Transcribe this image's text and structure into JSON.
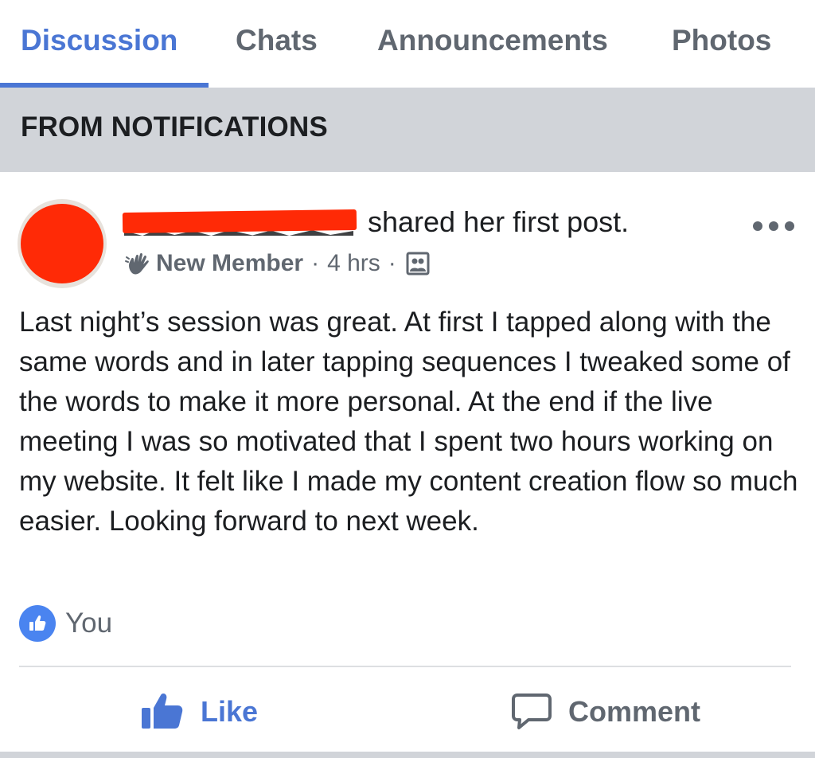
{
  "tabs": [
    {
      "label": "Discussion",
      "active": true
    },
    {
      "label": "Chats",
      "active": false
    },
    {
      "label": "Announcements",
      "active": false
    },
    {
      "label": "Photos",
      "active": false
    }
  ],
  "section": {
    "title": "FROM NOTIFICATIONS"
  },
  "post": {
    "author_redacted": true,
    "action_text": "shared her first post.",
    "badge_icon": "wave-hand-icon",
    "badge_label": "New Member",
    "separator": "·",
    "time": "4 hrs",
    "audience_icon": "group-icon",
    "body": "Last night’s session was great. At first I tapped along with the same words and in later tapping sequences I tweaked some of the words to make it more personal. At the end if the live meeting I was so motivated that I spent two hours working on my website. It felt like I made my content creation flow so much easier. Looking forward to next week.",
    "reactions": {
      "icon": "thumbs-up-icon",
      "by": "You"
    }
  },
  "actions": {
    "like": "Like",
    "comment": "Comment"
  },
  "colors": {
    "accent": "#4a76d4",
    "muted": "#606770",
    "section_bg": "#d1d4d9",
    "redaction": "#ff2a06"
  }
}
